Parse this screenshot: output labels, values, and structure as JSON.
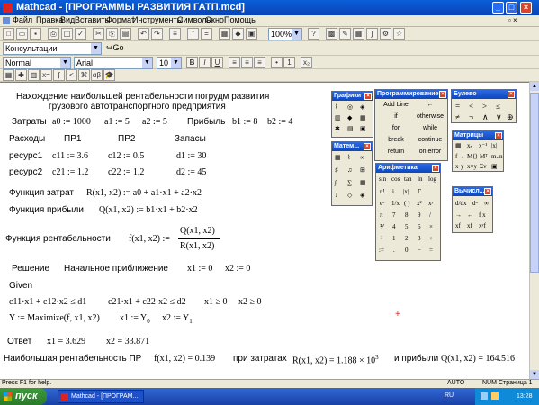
{
  "window": {
    "title": "Mathcad - [ПРОГРАММЫ РАЗВИТИЯ ГАТП.mcd]"
  },
  "menu": [
    "Файл",
    "Правка",
    "Вид",
    "Вставить",
    "Формат",
    "Инструменты",
    "Символы",
    "Окно",
    "Помощь"
  ],
  "toolbar": {
    "zoom": "100%",
    "style_combo": "Консультации",
    "go_label": "Go",
    "font_style": "Normal",
    "font_name": "Arial",
    "font_size": "10",
    "bold": "B",
    "italic": "I",
    "underline": "U"
  },
  "document": {
    "heading1": "Нахождение наибольшей рентабельности погрудм развития",
    "heading2": "грузового автотранспортного предприятия",
    "costs_label": "Затраты",
    "a0": "a0 := 1000",
    "a1": "a1 := 5",
    "a2": "a2 := 5",
    "profit_label": "Прибыль",
    "b1": "b1 := 8",
    "b2": "b2 := 4",
    "expenses_label": "Расходы",
    "pr1": "ПР1",
    "pr2": "ПР2",
    "stocks_label": "Запасы",
    "res1": "ресурс1",
    "c11": "c11 := 3.6",
    "c12": "c12 := 0.5",
    "d1": "d1 := 30",
    "res2": "ресурс2",
    "c21": "c21 := 1.2",
    "c22": "c22 := 1.2",
    "d2": "d2 := 45",
    "cost_fn_label": "Функция затрат",
    "cost_fn": "R(x1, x2) := a0 + a1·x1 + a2·x2",
    "profit_fn_label": "Функция прибыли",
    "profit_fn": "Q(x1, x2) := b1·x1 + b2·x2",
    "rent_fn_label": "Функция рентабельности",
    "rent_fn_lhs": "f(x1, x2) :=",
    "rent_num": "Q(x1, x2)",
    "rent_den": "R(x1, x2)",
    "solution_label": "Решение",
    "init_label": "Начальное приближение",
    "x1_init": "x1 := 0",
    "x2_init": "x2 := 0",
    "given": "Given",
    "constraint1": "c11·x1 + c12·x2 ≤ d1",
    "constraint2": "c21·x1 + c22·x2 ≤ d2",
    "constraint3": "x1 ≥ 0",
    "constraint4": "x2 ≥ 0",
    "maximize": "Y := Maximize(f, x1, x2)",
    "assign_x1": "x1 := Y",
    "assign_x1_sub": "0",
    "assign_x2": "x2 := Y",
    "assign_x2_sub": "1",
    "answer_label": "Ответ",
    "x1_ans": "x1 = 3.629",
    "x2_ans": "x2 = 33.871",
    "result_label": "Наибольшая рентабельность ПР",
    "f_result": "f(x1, x2) = 0.139",
    "at_costs": "при затратах",
    "r_result": "R(x1, x2) = 1.188 × 10",
    "r_exp": "3",
    "and_profit": "и прибыли",
    "q_result": "Q(x1, x2) = 164.516"
  },
  "palettes": {
    "graphs": "Графики",
    "programming": {
      "title": "Программирование",
      "buttons": [
        "Add Line",
        "←",
        "if",
        "otherwise",
        "for",
        "while",
        "break",
        "continue",
        "return",
        "on error"
      ]
    },
    "boolean": {
      "title": "Булево",
      "symbols": [
        "=",
        "<",
        ">",
        "≤",
        "≠",
        "¬",
        "∧",
        "∨",
        "⊕"
      ]
    },
    "math": "Матем...",
    "arithmetic": {
      "title": "Арифметика",
      "keys": [
        "sin",
        "cos",
        "tan",
        "ln",
        "log",
        "n!",
        "i",
        "|x|",
        "Γ",
        "eˣ",
        "1/x",
        "( )",
        "x²",
        "xʸ",
        "π",
        "7",
        "8",
        "9",
        "/",
        "⅟",
        "4",
        "5",
        "6",
        "×",
        "÷",
        "1",
        "2",
        "3",
        "+",
        ":=",
        ".",
        "0",
        "−",
        "="
      ]
    },
    "matrices": "Матрицы",
    "calculus": "Вычисл..."
  },
  "status": {
    "help": "Press F1 for help.",
    "auto": "AUTO",
    "num": "NUM",
    "page": "Страница 1"
  },
  "taskbar": {
    "start": "пуск",
    "task": "Mathcad - [ПРОГРАМ...",
    "lang": "RU",
    "clock": "13:28"
  }
}
